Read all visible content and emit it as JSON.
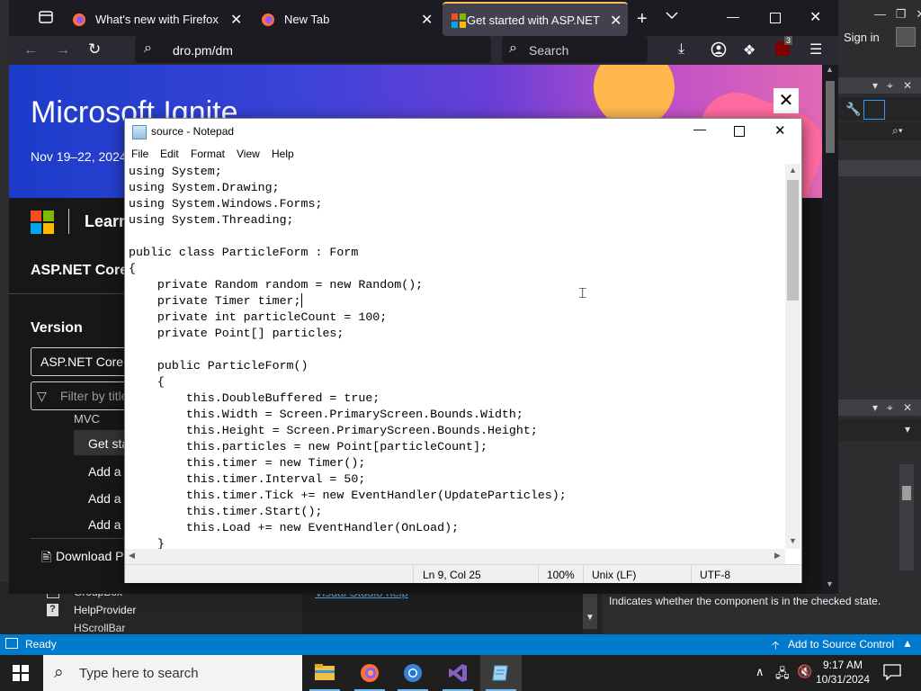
{
  "firefox": {
    "tabs": [
      {
        "label": "What's new with Firefox"
      },
      {
        "label": "New Tab"
      },
      {
        "label": "Get started with ASP.NET Core"
      }
    ],
    "url": "dro.pm/dm",
    "search_placeholder": "Search",
    "extension_badge": "3"
  },
  "page": {
    "banner_title": "Microsoft Ignite",
    "banner_date": "Nov 19–22, 2024",
    "learn_label": "Learn",
    "breadcrumb_title": "ASP.NET Core",
    "version_heading": "Version",
    "version_value": "ASP.NET Core in",
    "filter_placeholder": "Filter by title",
    "nav_items": [
      "MVC",
      "Get started",
      "Add a",
      "Add a",
      "Add a"
    ],
    "download_label": "Download PDF"
  },
  "visual_studio": {
    "sign_in": "Sign in",
    "toolbox_items": [
      "GroupBox",
      "HelpProvider",
      "HScrollBar"
    ],
    "link_text": "Visual Studio help",
    "property_description": "Indicates whether the component is in the checked state.",
    "status_ready": "Ready",
    "status_source_control": "Add to Source Control"
  },
  "notepad": {
    "title": "source - Notepad",
    "menu": [
      "File",
      "Edit",
      "Format",
      "View",
      "Help"
    ],
    "lines": [
      "using System;",
      "using System.Drawing;",
      "using System.Windows.Forms;",
      "using System.Threading;",
      "",
      "public class ParticleForm : Form",
      "{",
      "    private Random random = new Random();",
      "    private Timer timer;",
      "    private int particleCount = 100;",
      "    private Point[] particles;",
      "",
      "    public ParticleForm()",
      "    {",
      "        this.DoubleBuffered = true;",
      "        this.Width = Screen.PrimaryScreen.Bounds.Width;",
      "        this.Height = Screen.PrimaryScreen.Bounds.Height;",
      "        this.particles = new Point[particleCount];",
      "        this.timer = new Timer();",
      "        this.timer.Interval = 50;",
      "        this.timer.Tick += new EventHandler(UpdateParticles);",
      "        this.timer.Start();",
      "        this.Load += new EventHandler(OnLoad);",
      "    }"
    ],
    "status": {
      "position": "Ln 9, Col 25",
      "zoom": "100%",
      "line_ending": "Unix (LF)",
      "encoding": "UTF-8"
    }
  },
  "taskbar": {
    "search_placeholder": "Type here to search",
    "time": "9:17 AM",
    "date": "10/31/2024"
  },
  "icons": [
    "windows-start-icon",
    "search-icon",
    "file-explorer-icon",
    "firefox-icon",
    "chrome-icon",
    "visual-studio-icon",
    "notepad-icon",
    "chevron-up-icon",
    "network-icon",
    "volume-muted-icon",
    "notification-icon"
  ]
}
